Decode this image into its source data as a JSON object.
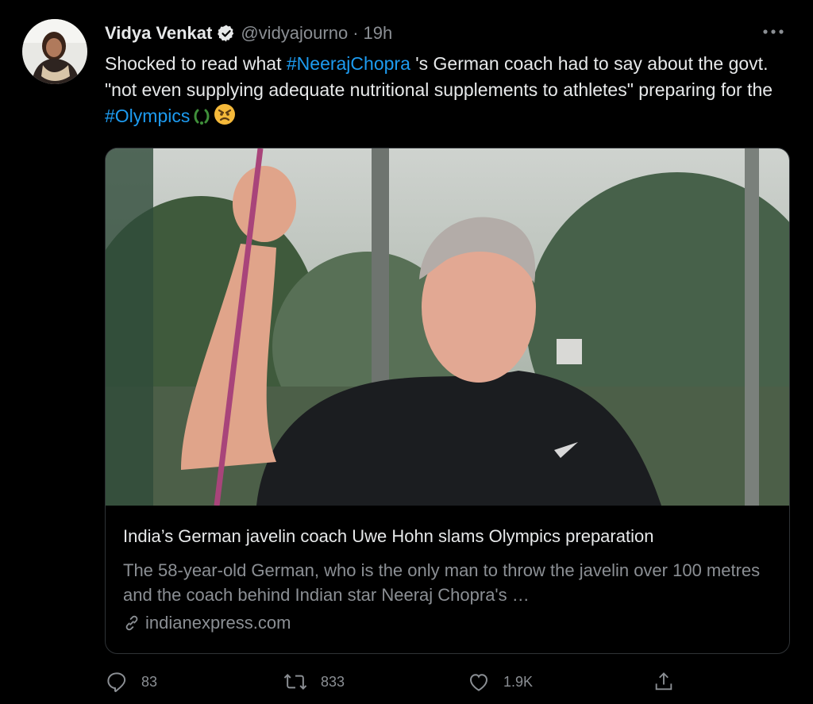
{
  "tweet": {
    "author_name": "Vidya Venkat",
    "handle": "@vidyajourno",
    "separator": "·",
    "time": "19h",
    "text": {
      "part1": "Shocked to read what ",
      "hashtag1": "#NeerajChopra",
      "part2": " 's German coach had to say about the govt. \"not even supplying adequate nutritional supplements to athletes\" preparing for the ",
      "hashtag2": "#Olympics"
    }
  },
  "card": {
    "title": "India’s German javelin coach Uwe Hohn slams Olympics preparation",
    "description": "The 58-year-old German, who is the only man to throw the javelin over 100 metres and the coach behind Indian star Neeraj Chopra's …",
    "domain": "indianexpress.com"
  },
  "actions": {
    "replies": "83",
    "retweets": "833",
    "likes": "1.9K"
  },
  "colors": {
    "link": "#1d9bf0",
    "muted": "#8b8f94",
    "background": "#000000"
  }
}
